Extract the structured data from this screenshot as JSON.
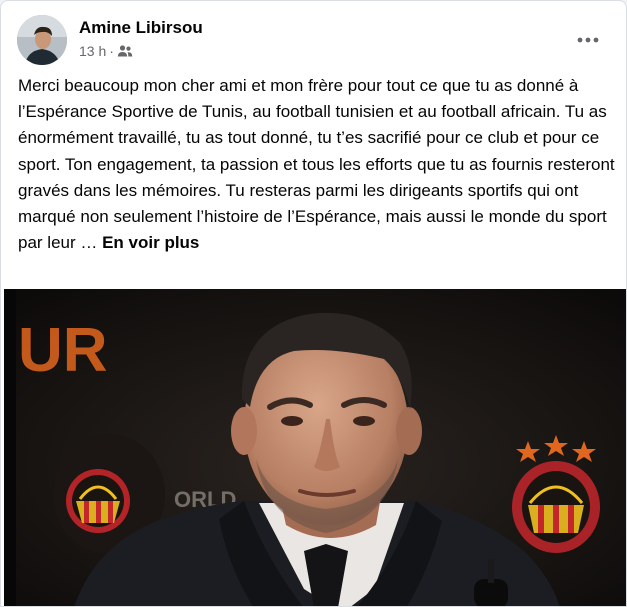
{
  "post": {
    "author": "Amine Libirsou",
    "time": "13 h",
    "separator": "·",
    "audience_icon": "group-icon",
    "more_icon": "more-icon",
    "text": "Merci beaucoup mon cher ami et mon frère pour tout ce que tu as donné à l’Espérance Sportive de Tunis, au football tunisien et au football africain. Tu as énormément travaillé, tu as tout donné, tu t’es sacrifié pour ce club et pour ce sport. Ton engagement, ta passion et tous les efforts que tu as fournis resteront gravés dans les mémoires. Tu resteras parmi les dirigeants sportifs qui ont marqué non seulement l’histoire de l’Espérance, mais aussi le monde du sport par leur … ",
    "see_more": "En voir plus"
  },
  "photo": {
    "banner_text_left": "UR",
    "banner_text_mid": "ORLD",
    "accent_orange": "#e2671e",
    "club_red": "#c3262b",
    "club_yellow": "#f0c020"
  },
  "colors": {
    "text": "#050505",
    "secondary": "#65676b",
    "background": "#ffffff"
  }
}
